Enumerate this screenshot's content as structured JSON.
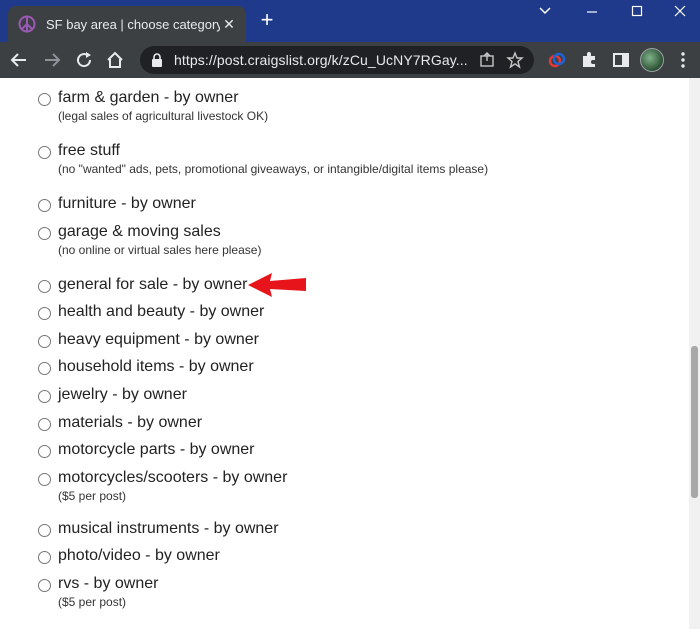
{
  "browser": {
    "tab_title": "SF bay area | choose category",
    "new_tab_label": "+",
    "url": "https://post.craigslist.org/k/zCu_UcNY7RGay..."
  },
  "colors": {
    "titlebar": "#1f3a8a",
    "toolbar": "#3c4043",
    "omnibox": "#202124",
    "arrow": "#e8141c"
  },
  "categories": [
    {
      "label": "farm & garden - by owner",
      "note": "(legal sales of agricultural livestock OK)"
    },
    {
      "label": "free stuff",
      "note": "(no \"wanted\" ads, pets, promotional giveaways, or intangible/digital items please)"
    },
    {
      "label": "furniture - by owner",
      "note": ""
    },
    {
      "label": "garage & moving sales",
      "note": "(no online or virtual sales here please)"
    },
    {
      "label": "general for sale - by owner",
      "note": ""
    },
    {
      "label": "health and beauty - by owner",
      "note": ""
    },
    {
      "label": "heavy equipment - by owner",
      "note": ""
    },
    {
      "label": "household items - by owner",
      "note": ""
    },
    {
      "label": "jewelry - by owner",
      "note": ""
    },
    {
      "label": "materials - by owner",
      "note": ""
    },
    {
      "label": "motorcycle parts - by owner",
      "note": ""
    },
    {
      "label": "motorcycles/scooters - by owner",
      "note": "($5 per post)"
    },
    {
      "label": "musical instruments - by owner",
      "note": ""
    },
    {
      "label": "photo/video - by owner",
      "note": ""
    },
    {
      "label": "rvs - by owner",
      "note": "($5 per post)"
    }
  ],
  "annotation": {
    "arrow_icon": "red-arrow-icon",
    "points_to": "general for sale - by owner"
  }
}
